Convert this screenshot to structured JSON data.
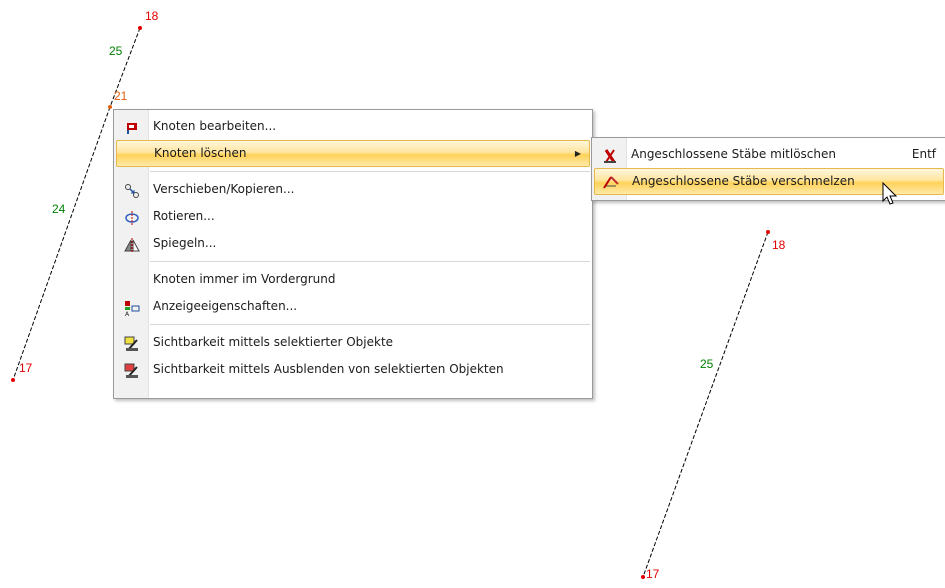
{
  "canvas": {
    "left_member": {
      "number": "24",
      "start_node": "21",
      "end_node": "17"
    },
    "top_member": {
      "number": "25",
      "start_node": "18",
      "end_node": "21"
    },
    "right_member": {
      "number": "25",
      "start_node": "18",
      "end_node": "17"
    },
    "colors": {
      "node_label": "#e00000",
      "selected_node_label": "#e06010",
      "member_label": "#008000"
    }
  },
  "context_menu": {
    "items": [
      {
        "label": "Knoten bearbeiten...",
        "icon": "edit-node-icon"
      },
      {
        "label": "Knoten löschen",
        "icon": "",
        "has_submenu": true,
        "highlighted": true
      },
      {
        "label": "Verschieben/Kopieren...",
        "icon": "move-copy-icon"
      },
      {
        "label": "Rotieren...",
        "icon": "rotate-icon"
      },
      {
        "label": "Spiegeln...",
        "icon": "mirror-icon"
      },
      {
        "label": "Knoten immer im Vordergrund",
        "icon": ""
      },
      {
        "label": "Anzeigeeigenschaften...",
        "icon": "display-properties-icon"
      },
      {
        "label": "Sichtbarkeit mittels selektierter Objekte",
        "icon": "visibility-selected-icon"
      },
      {
        "label": "Sichtbarkeit mittels Ausblenden von selektierten Objekten",
        "icon": "visibility-hide-selected-icon"
      }
    ]
  },
  "submenu": {
    "items": [
      {
        "label": "Angeschlossene Stäbe mitlöschen",
        "shortcut": "Entf",
        "icon": "delete-members-icon"
      },
      {
        "label": "Angeschlossene Stäbe verschmelzen",
        "shortcut": "",
        "icon": "merge-members-icon",
        "highlighted": true
      }
    ]
  }
}
